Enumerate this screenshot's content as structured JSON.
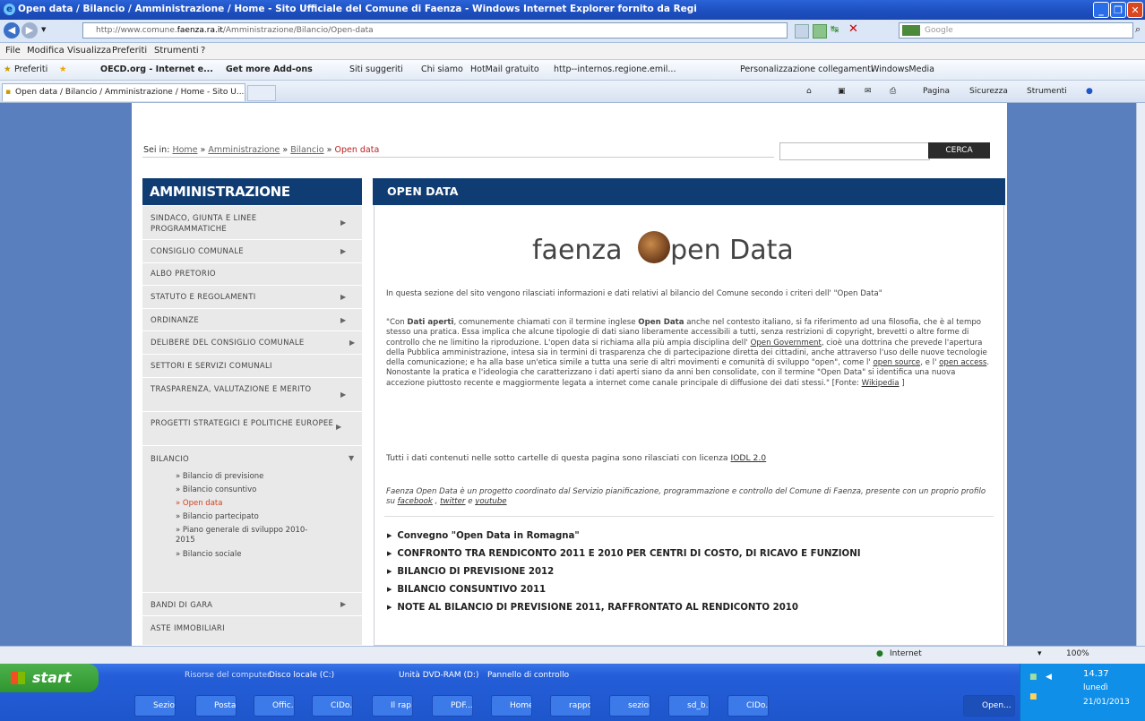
{
  "window": {
    "title": "Open data / Bilancio / Amministrazione / Home - Sito Ufficiale del Comune di Faenza - Windows Internet Explorer fornito da Regi"
  },
  "address": {
    "url_prefix": "http://www.comune.",
    "url_domain": "faenza.ra.it",
    "url_path": "/Amministrazione/Bilancio/Open-data",
    "search_placeholder": "Google"
  },
  "menu": [
    "File",
    "Modifica",
    "Visualizza",
    "Preferiti",
    "Strumenti",
    "?"
  ],
  "favorites": {
    "label": "Preferiti",
    "items": [
      "OECD.org - Internet e...",
      "Get more Add-ons",
      "Siti suggeriti",
      "Chi siamo",
      "HotMail gratuito",
      "http--internos.regione.emil...",
      "Personalizzazione collegamenti",
      "WindowsMedia"
    ]
  },
  "tab": {
    "label": "Open data / Bilancio / Amministrazione / Home - Sito U..."
  },
  "commandbar": {
    "pagina": "Pagina",
    "sicurezza": "Sicurezza",
    "strumenti": "Strumenti"
  },
  "breadcrumb": {
    "prefix": "Sei in:",
    "home": "Home",
    "amministrazione": "Amministrazione",
    "bilancio": "Bilancio",
    "current": "Open data",
    "sep": "»"
  },
  "search": {
    "button": "CERCA"
  },
  "sidebar": {
    "title": "AMMINISTRAZIONE",
    "items": [
      {
        "label": "SINDACO, GIUNTA E LINEE PROGRAMMATICHE",
        "arrow": "▶"
      },
      {
        "label": "CONSIGLIO COMUNALE",
        "arrow": "▶"
      },
      {
        "label": "ALBO PRETORIO",
        "arrow": ""
      },
      {
        "label": "STATUTO E REGOLAMENTI",
        "arrow": "▶"
      },
      {
        "label": "ORDINANZE",
        "arrow": "▶"
      },
      {
        "label": "DELIBERE DEL CONSIGLIO COMUNALE",
        "arrow": "▶"
      },
      {
        "label": "SETTORI E SERVIZI COMUNALI",
        "arrow": ""
      },
      {
        "label": "TRASPARENZA, VALUTAZIONE E MERITO",
        "arrow": "▶"
      },
      {
        "label": "PROGETTI STRATEGICI E POLITICHE EUROPEE",
        "arrow": "▶"
      },
      {
        "label": "BILANCIO",
        "arrow": "▼"
      },
      {
        "label": "BANDI DI GARA",
        "arrow": "▶"
      },
      {
        "label": "ASTE IMMOBILIARI",
        "arrow": ""
      }
    ],
    "bilancio_sub": [
      "» Bilancio di previsione",
      "» Bilancio consuntivo",
      "» Open data",
      "» Bilancio partecipato",
      "» Piano generale di sviluppo 2010-2015",
      "» Bilancio sociale"
    ]
  },
  "main": {
    "title": "OPEN DATA",
    "logo_left": "faenza",
    "logo_right": "pen Data",
    "intro": "In questa sezione del sito vengono rilasciati informazioni e dati relativi al bilancio del Comune secondo i criteri dell' \"Open Data\"",
    "quote": {
      "t1": "\"Con ",
      "b1": "Dati aperti",
      "t2": ", comunemente chiamati con il termine inglese ",
      "b2": "Open Data",
      "t3": " anche nel contesto italiano, si fa riferimento ad una filosofia, che è al tempo stesso una pratica. Essa implica che alcune tipologie di dati siano liberamente accessibili a tutti, senza restrizioni di copyright, brevetti o altre forme di controllo che ne limitino la riproduzione. L'open data si richiama alla più ampia disciplina dell' ",
      "l1": "Open Government",
      "t4": ", cioè una dottrina che prevede l'apertura della Pubblica amministrazione, intesa sia in termini di trasparenza che di partecipazione diretta dei cittadini, anche attraverso l'uso delle nuove tecnologie della comunicazione; e ha alla base un'etica simile a tutta una serie di altri movimenti e comunità di sviluppo \"open\", come l' ",
      "l2": "open source",
      "t5": ", e l' ",
      "l3": "open access",
      "t6": ". Nonostante la pratica e l'ideologia che caratterizzano i dati aperti siano da anni ben consolidate, con il termine \"Open Data\" si identifica una nuova accezione piuttosto recente e maggiormente legata a internet come canale principale di diffusione dei dati stessi.\" [Fonte: ",
      "l4": "Wikipedia",
      "t7": " ]"
    },
    "license": {
      "text": "Tutti i dati contenuti nelle sotto cartelle di questa pagina sono rilasciati con licenza ",
      "link": "IODL 2.0"
    },
    "project": {
      "t1": "Faenza Open Data è un progetto coordinato dal Servizio pianificazione, programmazione e controllo del Comune di Faenza, presente con un proprio profilo su ",
      "l1": "facebook",
      "t2": " , ",
      "l2": "twitter",
      "t3": " e ",
      "l3": "youtube"
    },
    "links": [
      "Convegno \"Open Data in Romagna\"",
      "CONFRONTO TRA RENDICONTO 2011 E 2010 PER CENTRI DI COSTO, DI RICAVO E FUNZIONI",
      "BILANCIO DI PREVISIONE 2012",
      "BILANCIO CONSUNTIVO 2011",
      "NOTE AL BILANCIO DI PREVISIONE 2011, RAFFRONTATO AL RENDICONTO 2010"
    ]
  },
  "status": {
    "zone": "Internet",
    "zoom": "100%"
  },
  "taskbar": {
    "start": "start",
    "quicklaunch": [
      "Risorse del computer",
      "Disco locale (C:)",
      "Unità DVD-RAM (D:)",
      "Pannello di controllo"
    ],
    "items": [
      "Sezio...",
      "Posta...",
      "Offic...",
      "CIDo...",
      "Il rap...",
      "PDF...",
      "Home...",
      "rappo...",
      "sezion...",
      "sd_b...",
      "CIDo...",
      "Open..."
    ],
    "time": "14.37",
    "day": "lunedì",
    "date": "21/01/2013"
  },
  "colors": {
    "header_bg": "#0f3d73",
    "sidebar_bg": "#e9e9e9",
    "page_bg": "#5a7fbf",
    "active_sub": "#d4401f"
  }
}
